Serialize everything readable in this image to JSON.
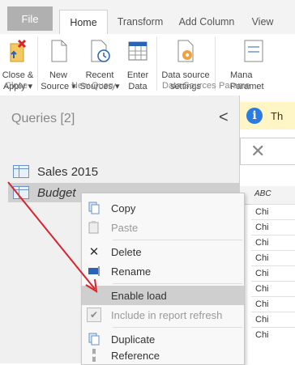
{
  "tabs": {
    "file": "File",
    "home": "Home",
    "transform": "Transform",
    "add_column": "Add Column",
    "view": "View"
  },
  "ribbon": {
    "close_apply": "Close &\nApply ▾",
    "new_source": "New\nSource ▾",
    "recent_sources": "Recent\nSources ▾",
    "enter_data": "Enter\nData",
    "data_source_settings": "Data source\nsettings",
    "manage_parameters": "Mana\nParamet",
    "groups": {
      "close": "Close",
      "new_query": "New Query",
      "data_sources": "Data Sources",
      "parameters": "Parame"
    }
  },
  "queries": {
    "header": "Queries [2]",
    "collapse": "<",
    "items": [
      {
        "label": "Sales 2015"
      },
      {
        "label": "Budget"
      }
    ]
  },
  "preview": {
    "info_text": "Th",
    "column_type": "ABC",
    "cells": [
      "Chi",
      "Chi",
      "Chi",
      "Chi",
      "Chi",
      "Chi",
      "Chi",
      "Chi",
      "Chi"
    ]
  },
  "context_menu": {
    "items": [
      {
        "label": "Copy",
        "icon": "copy-icon",
        "enabled": true
      },
      {
        "label": "Paste",
        "icon": "paste-icon",
        "enabled": false
      },
      {
        "label": "Delete",
        "icon": "delete-icon",
        "enabled": true
      },
      {
        "label": "Rename",
        "icon": "rename-icon",
        "enabled": true
      },
      {
        "label": "Enable load",
        "icon": "",
        "enabled": true,
        "highlighted": true
      },
      {
        "label": "Include in report refresh",
        "icon": "checkbox-icon",
        "enabled": false
      },
      {
        "label": "Duplicate",
        "icon": "duplicate-icon",
        "enabled": true
      },
      {
        "label": "Reference",
        "icon": "reference-icon",
        "enabled": true
      }
    ]
  },
  "colors": {
    "accent_blue": "#2c7be0",
    "annotation_arrow": "#d9232d",
    "info_bar": "#fff5c5",
    "ribbon_icon_orange": "#f29f3c"
  }
}
